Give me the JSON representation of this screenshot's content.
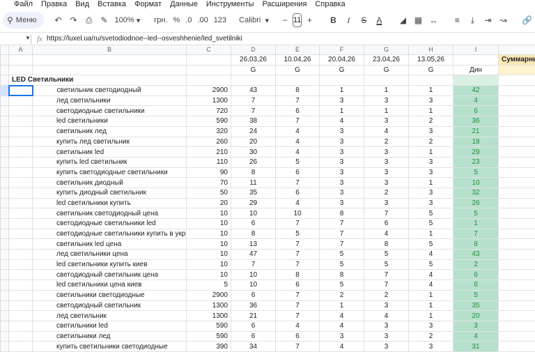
{
  "menu": [
    "Файл",
    "Правка",
    "Вид",
    "Вставка",
    "Формат",
    "Данные",
    "Инструменты",
    "Расширения",
    "Справка"
  ],
  "toolbar": {
    "search_label": "Меню",
    "zoom": "100%",
    "currency": "грн.",
    "percent": "%",
    "decimal_dec": ".0",
    "decimal_inc": ".00",
    "number_format": "123",
    "font": "Calibri",
    "font_size": "11",
    "minus": "−",
    "plus": "+",
    "bold": "B",
    "italic": "I",
    "strike": "S",
    "text_color": "A"
  },
  "formula_bar": {
    "fx": "fx",
    "content": "https://luxel.ua/ru/svetodiodnoe--led--osveshhenie/led_svetilniki"
  },
  "columns": [
    "A",
    "B",
    "C",
    "D",
    "E",
    "F",
    "G",
    "H",
    "I"
  ],
  "header_dates": [
    "26,03,26",
    "10.04,26",
    "20.04,26",
    "23.04,26",
    "13.05,26"
  ],
  "header_g": [
    "G",
    "G",
    "G",
    "G",
    "G"
  ],
  "din_label": "Дин",
  "summary_label": "Суммарный",
  "section_title": "LED Светильники",
  "rows": [
    {
      "keyword": "светильник светодиодный",
      "volume": "2900",
      "positions": [
        "43",
        "8",
        "1",
        "1",
        "1"
      ],
      "din": "42"
    },
    {
      "keyword": "лед светильники",
      "volume": "1300",
      "positions": [
        "7",
        "7",
        "3",
        "3",
        "3"
      ],
      "din": "4"
    },
    {
      "keyword": "светодиодные светильники",
      "volume": "720",
      "positions": [
        "7",
        "6",
        "1",
        "1",
        "1"
      ],
      "din": "6"
    },
    {
      "keyword": "led светильники",
      "volume": "590",
      "positions": [
        "38",
        "7",
        "4",
        "3",
        "2"
      ],
      "din": "36"
    },
    {
      "keyword": "светильник лед",
      "volume": "320",
      "positions": [
        "24",
        "4",
        "3",
        "4",
        "3"
      ],
      "din": "21"
    },
    {
      "keyword": "купить лед светильник",
      "volume": "260",
      "positions": [
        "20",
        "4",
        "3",
        "2",
        "2"
      ],
      "din": "18"
    },
    {
      "keyword": "светильник led",
      "volume": "210",
      "positions": [
        "30",
        "4",
        "3",
        "3",
        "1"
      ],
      "din": "29"
    },
    {
      "keyword": "купить led светильник",
      "volume": "110",
      "positions": [
        "26",
        "5",
        "3",
        "3",
        "3"
      ],
      "din": "23"
    },
    {
      "keyword": "купить светодиодные светильники",
      "volume": "90",
      "positions": [
        "8",
        "6",
        "3",
        "3",
        "3"
      ],
      "din": "5"
    },
    {
      "keyword": "светильник диодный",
      "volume": "70",
      "positions": [
        "11",
        "7",
        "3",
        "3",
        "1"
      ],
      "din": "10"
    },
    {
      "keyword": "купить диодный светильник",
      "volume": "50",
      "positions": [
        "35",
        "6",
        "3",
        "2",
        "3"
      ],
      "din": "32"
    },
    {
      "keyword": "led светильники купить",
      "volume": "20",
      "positions": [
        "29",
        "4",
        "3",
        "3",
        "3"
      ],
      "din": "26"
    },
    {
      "keyword": "светильник светодиодный цена",
      "volume": "10",
      "positions": [
        "10",
        "10",
        "8",
        "7",
        "5"
      ],
      "din": "5"
    },
    {
      "keyword": "светодиодные светильники led",
      "volume": "10",
      "positions": [
        "6",
        "7",
        "7",
        "6",
        "5"
      ],
      "din": "1"
    },
    {
      "keyword": "светодиодные светильники купить в украине",
      "volume": "10",
      "positions": [
        "8",
        "5",
        "7",
        "4",
        "1"
      ],
      "din": "7"
    },
    {
      "keyword": "светильник led цена",
      "volume": "10",
      "positions": [
        "13",
        "7",
        "7",
        "8",
        "5"
      ],
      "din": "8"
    },
    {
      "keyword": "лед светильники цена",
      "volume": "10",
      "positions": [
        "47",
        "7",
        "5",
        "5",
        "4"
      ],
      "din": "43"
    },
    {
      "keyword": "led светильники купить киев",
      "volume": "10",
      "positions": [
        "7",
        "7",
        "5",
        "5",
        "5"
      ],
      "din": "2"
    },
    {
      "keyword": "светодиодный светильник цена",
      "volume": "10",
      "positions": [
        "10",
        "8",
        "8",
        "7",
        "4"
      ],
      "din": "6"
    },
    {
      "keyword": "led светильники цена киев",
      "volume": "5",
      "positions": [
        "10",
        "6",
        "5",
        "7",
        "4"
      ],
      "din": "6"
    },
    {
      "keyword": "светильники светодиодные",
      "volume": "2900",
      "positions": [
        "6",
        "7",
        "2",
        "2",
        "1"
      ],
      "din": "5"
    },
    {
      "keyword": "светодиодный светильник",
      "volume": "1300",
      "positions": [
        "36",
        "7",
        "1",
        "3",
        "1"
      ],
      "din": "35"
    },
    {
      "keyword": "лед светильник",
      "volume": "1300",
      "positions": [
        "21",
        "7",
        "4",
        "4",
        "1"
      ],
      "din": "20"
    },
    {
      "keyword": "светильники led",
      "volume": "590",
      "positions": [
        "6",
        "4",
        "4",
        "3",
        "3"
      ],
      "din": "3"
    },
    {
      "keyword": "светильники лед",
      "volume": "590",
      "positions": [
        "6",
        "6",
        "3",
        "3",
        "2"
      ],
      "din": "4"
    },
    {
      "keyword": "купить светильники светодиодные",
      "volume": "390",
      "positions": [
        "34",
        "7",
        "4",
        "3",
        "3"
      ],
      "din": "31"
    }
  ]
}
